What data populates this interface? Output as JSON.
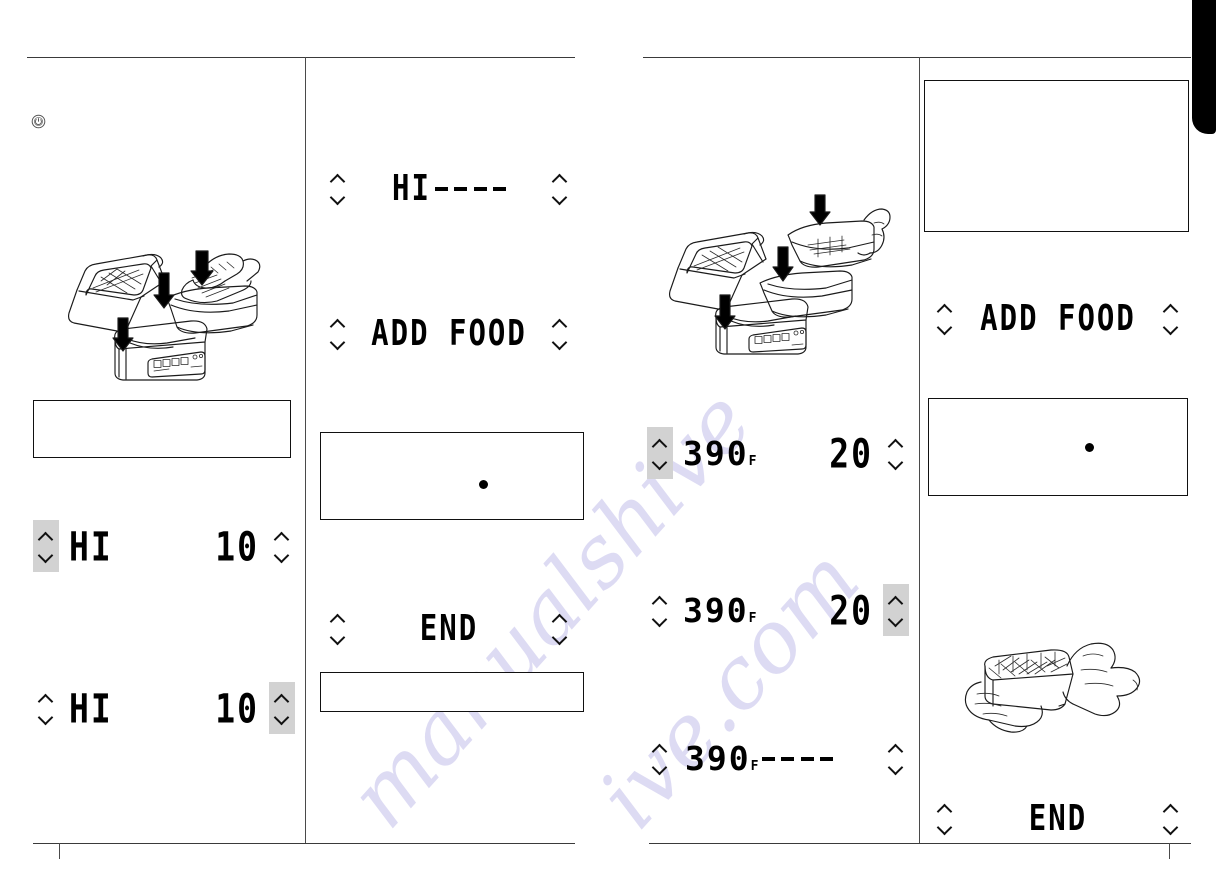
{
  "document": {
    "kind": "appliance-manual-spread",
    "watermarks": [
      "manualshive.com",
      "manualshive.com"
    ]
  },
  "icons": {
    "power": "power-standby-icon",
    "chevron_up": "chevron-up-icon",
    "chevron_down": "chevron-down-icon",
    "bullet": "bullet-dot-icon"
  },
  "left_page": {
    "column_a": {
      "displays": [
        {
          "name": "hi-10-temp-selected",
          "left_value": "HI",
          "right_value": "10",
          "unit": "",
          "highlight": "left"
        },
        {
          "name": "hi-10-time-selected",
          "left_value": "HI",
          "right_value": "10",
          "unit": "",
          "highlight": "right"
        }
      ],
      "illustration": "grill-lid-open-with-basket-and-hand-adding-food",
      "note_boxes": [
        {
          "name": "tip-box",
          "text": ""
        }
      ]
    },
    "column_b": {
      "displays": [
        {
          "name": "hi-preheat-dashes",
          "left_value": "HI",
          "right_value": "",
          "unit": "",
          "dashes": true,
          "highlight": "none"
        },
        {
          "name": "add-food-prompt",
          "left_value": "ADD FOOD",
          "right_value": "",
          "unit": "",
          "highlight": "none"
        },
        {
          "name": "end-prompt",
          "left_value": "END",
          "right_value": "",
          "unit": "",
          "highlight": "none"
        }
      ],
      "note_boxes": [
        {
          "name": "caution-box-with-bullet",
          "text": "",
          "has_bullet": true
        },
        {
          "name": "tip-box",
          "text": ""
        }
      ]
    }
  },
  "right_page": {
    "column_c": {
      "illustration": "grill-lid-open-crisper-basket-and-hand-adding-food",
      "displays": [
        {
          "name": "temp-390-time-20-temp-selected",
          "left_value": "390",
          "unit": "F",
          "right_value": "20",
          "highlight": "left"
        },
        {
          "name": "temp-390-time-20-time-selected",
          "left_value": "390",
          "unit": "F",
          "right_value": "20",
          "highlight": "right"
        },
        {
          "name": "temp-390-preheat-dashes",
          "left_value": "390",
          "unit": "F",
          "right_value": "",
          "dashes": true,
          "highlight": "none"
        }
      ]
    },
    "column_d": {
      "note_boxes": [
        {
          "name": "intro-box",
          "text": ""
        },
        {
          "name": "caution-box-with-bullet",
          "text": "",
          "has_bullet": true
        }
      ],
      "displays": [
        {
          "name": "add-food-prompt",
          "left_value": "ADD FOOD",
          "right_value": "",
          "unit": "",
          "highlight": "none"
        },
        {
          "name": "end-prompt",
          "left_value": "END",
          "right_value": "",
          "unit": "",
          "highlight": "none"
        }
      ],
      "illustration": "hands-shaking-crisper-basket-with-fries"
    }
  }
}
